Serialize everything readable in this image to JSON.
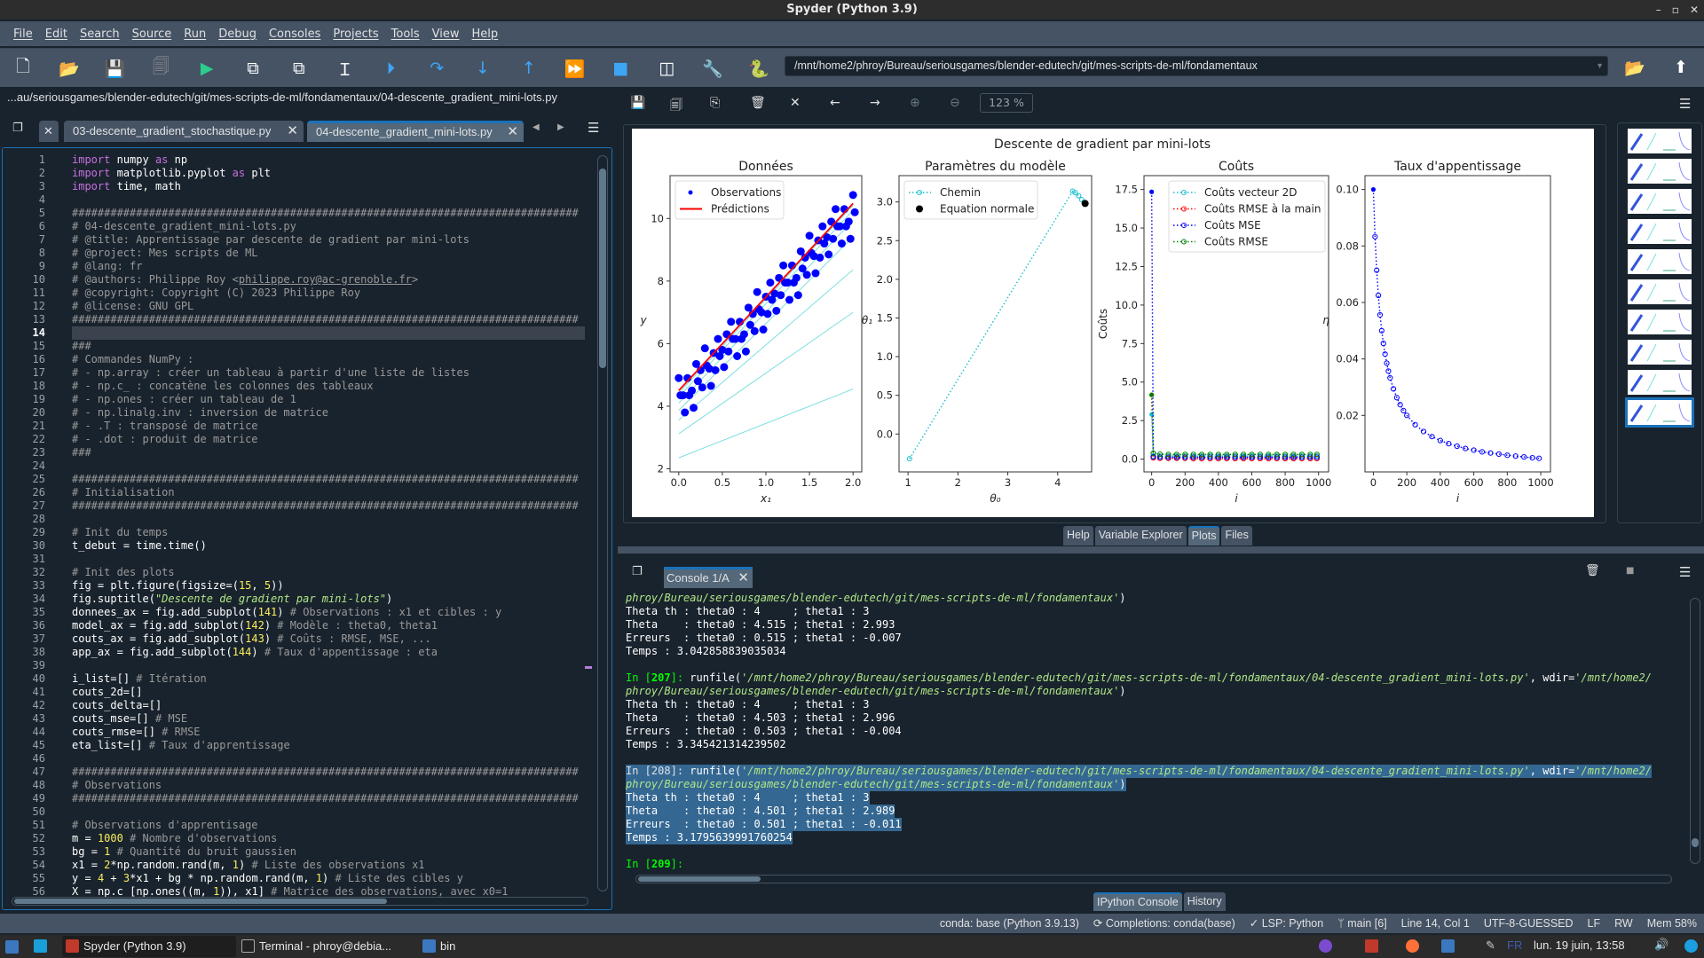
{
  "window": {
    "title": "Spyder (Python 3.9)",
    "controls": [
      "–",
      "▫",
      "✕"
    ]
  },
  "menu": [
    "File",
    "Edit",
    "Search",
    "Source",
    "Run",
    "Debug",
    "Consoles",
    "Projects",
    "Tools",
    "View",
    "Help"
  ],
  "toolbar": {
    "icons": [
      "new-file",
      "open-file",
      "save",
      "save-all",
      "run",
      "run-cell",
      "run-cell-advance",
      "run-selection",
      "debug",
      "step",
      "step-into",
      "step-return",
      "continue",
      "stop",
      "maximize-pane",
      "preferences",
      "python-path-manager"
    ],
    "working_dir": "/mnt/home2/phroy/Bureau/seriousgames/blender-edutech/git/mes-scripts-de-ml/fondamentaux"
  },
  "editor": {
    "path": "...au/seriousgames/blender-edutech/git/mes-scripts-de-ml/fondamentaux/04-descente_gradient_mini-lots.py",
    "tabs": [
      {
        "label": "03-descente_gradient_stochastique.py",
        "active": false
      },
      {
        "label": "04-descente_gradient_mini-lots.py",
        "active": true
      }
    ],
    "current_line": 14,
    "lines": [
      "import numpy as np",
      "import matplotlib.pyplot as plt",
      "import time, math",
      "",
      "###############################################################################",
      "# 04-descente_gradient_mini-lots.py",
      "# @title: Apprentissage par descente de gradient par mini-lots",
      "# @project: Mes scripts de ML",
      "# @lang: fr",
      "# @authors: Philippe Roy <philippe.roy@ac-grenoble.fr>",
      "# @copyright: Copyright (C) 2023 Philippe Roy",
      "# @license: GNU GPL",
      "###############################################################################",
      "",
      "###",
      "# Commandes NumPy :",
      "# - np.array : créer un tableau à partir d'une liste de listes",
      "# - np.c_ : concatène les colonnes des tableaux",
      "# - np.ones : créer un tableau de 1",
      "# - np.linalg.inv : inversion de matrice",
      "# - .T : transposé de matrice",
      "# - .dot : produit de matrice",
      "###",
      "",
      "###############################################################################",
      "# Initialisation",
      "###############################################################################",
      "",
      "# Init du temps",
      "t_debut = time.time()",
      "",
      "# Init des plots",
      "fig = plt.figure(figsize=(15, 5))",
      "fig.suptitle(\"Descente de gradient par mini-lots\")",
      "donnees_ax = fig.add_subplot(141) # Observations : x1 et cibles : y",
      "model_ax = fig.add_subplot(142) # Modèle : theta0, theta1",
      "couts_ax = fig.add_subplot(143) # Coûts : RMSE, MSE, ...",
      "app_ax = fig.add_subplot(144) # Taux d'appentissage : eta",
      "",
      "i_list=[] # Itération",
      "couts_2d=[]",
      "couts_delta=[]",
      "couts_mse=[] # MSE",
      "couts_rmse=[] # RMSE",
      "eta_list=[] # Taux d'apprentissage",
      "",
      "###############################################################################",
      "# Observations",
      "###############################################################################",
      "",
      "# Observations d'apprentisage",
      "m = 1000 # Nombre d'observations",
      "bg = 1 # Quantité du bruit gaussien",
      "x1 = 2*np.random.rand(m, 1) # Liste des observations x1",
      "y = 4 + 3*x1 + bg * np.random.rand(m, 1) # Liste des cibles y",
      "X = np.c_[np.ones((m, 1)), x1] # Matrice des observations, avec x0=1"
    ]
  },
  "plots": {
    "zoom": "123 %",
    "toolbar_icons": [
      "save-plot",
      "save-all-plots",
      "copy",
      "remove",
      "remove-all",
      "previous",
      "next",
      "zoom-in",
      "zoom-out"
    ],
    "thumbnail_count": 10,
    "selected_thumbnail": 10
  },
  "pane_tabs": [
    {
      "label": "Help",
      "active": false
    },
    {
      "label": "Variable Explorer",
      "active": false
    },
    {
      "label": "Plots",
      "active": true
    },
    {
      "label": "Files",
      "active": false
    }
  ],
  "console": {
    "tab": "Console 1/A",
    "lines": [
      {
        "t": "cont",
        "text": "phroy/Bureau/seriousgames/blender-edutech/git/mes-scripts-de-ml/fondamentaux'",
        "tail": ")"
      },
      {
        "t": "out",
        "text": "Theta th : theta0 : 4     ; theta1 : 3"
      },
      {
        "t": "out",
        "text": "Theta    : theta0 : 4.515 ; theta1 : 2.993"
      },
      {
        "t": "out",
        "text": "Erreurs  : theta0 : 0.515 ; theta1 : -0.007"
      },
      {
        "t": "out",
        "text": "Temps : 3.042858839035034"
      },
      {
        "t": "out",
        "text": ""
      },
      {
        "t": "cmd",
        "n": "207",
        "pre": "runfile(",
        "s1": "'/mnt/home2/phroy/Bureau/seriousgames/blender-edutech/git/mes-scripts-de-ml/fondamentaux/04-descente_gradient_mini-lots.py'",
        "mid": ", wdir=",
        "s2": "'/mnt/home2/"
      },
      {
        "t": "cont",
        "text": "phroy/Bureau/seriousgames/blender-edutech/git/mes-scripts-de-ml/fondamentaux'",
        "tail": ")"
      },
      {
        "t": "out",
        "text": "Theta th : theta0 : 4     ; theta1 : 3"
      },
      {
        "t": "out",
        "text": "Theta    : theta0 : 4.503 ; theta1 : 2.996"
      },
      {
        "t": "out",
        "text": "Erreurs  : theta0 : 0.503 ; theta1 : -0.004"
      },
      {
        "t": "out",
        "text": "Temps : 3.345421314239502"
      },
      {
        "t": "out",
        "text": ""
      },
      {
        "t": "cmd",
        "sel": true,
        "n": "208",
        "pre": "runfile(",
        "s1": "'/mnt/home2/phroy/Bureau/seriousgames/blender-edutech/git/mes-scripts-de-ml/fondamentaux/04-descente_gradient_mini-lots.py'",
        "mid": ", wdir=",
        "s2": "'/mnt/home2/"
      },
      {
        "t": "cont",
        "sel": true,
        "text": "phroy/Bureau/seriousgames/blender-edutech/git/mes-scripts-de-ml/fondamentaux'",
        "tail": ")"
      },
      {
        "t": "out",
        "sel": true,
        "text": "Theta th : theta0 : 4     ; theta1 : 3"
      },
      {
        "t": "out",
        "sel": true,
        "text": "Theta    : theta0 : 4.501 ; theta1 : 2.989"
      },
      {
        "t": "out",
        "sel": true,
        "text": "Erreurs  : theta0 : 0.501 ; theta1 : -0.011"
      },
      {
        "t": "out",
        "sel": true,
        "text": "Temps : 3.1795639991760254"
      },
      {
        "t": "out",
        "text": ""
      },
      {
        "t": "prompt",
        "n": "209"
      }
    ]
  },
  "bottom_tabs": [
    {
      "label": "IPython Console",
      "active": true
    },
    {
      "label": "History",
      "active": false
    }
  ],
  "status": {
    "conda": "conda: base (Python 3.9.13)",
    "completions": "Completions: conda(base)",
    "lsp": "LSP: Python",
    "git": "main [6]",
    "position": "Line 14, Col 1",
    "encoding": "UTF-8-GUESSED",
    "eol": "LF",
    "rw": "RW",
    "mem": "Mem 58%"
  },
  "taskbar": {
    "tasks": [
      "Spyder (Python 3.9)",
      "Terminal - phroy@debia...",
      "bin"
    ],
    "lang": "FR",
    "clock": "lun. 19 juin, 13:58"
  },
  "colors": {
    "accent": "#1a72bb",
    "bg": "#19232D",
    "panel": "#455364",
    "selection": "#346792"
  },
  "chart_data": [
    {
      "suptitle": "Descente de gradient par mini-lots"
    },
    {
      "type": "scatter",
      "title": "Données",
      "xlabel": "x₁",
      "ylabel": "y",
      "xlim": [
        -0.1,
        2.1
      ],
      "ylim": [
        1.9,
        11.37
      ],
      "xticks": [
        0.0,
        0.5,
        1.0,
        1.5,
        2.0
      ],
      "xticklabels": [
        "0.0",
        "0.5",
        "1.0",
        "1.5",
        "2.0"
      ],
      "yticks": [
        2,
        4,
        6,
        8,
        10
      ],
      "yticklabels": [
        "2",
        "4",
        "6",
        "8",
        "10"
      ],
      "legend": {
        "placement": "upper-left",
        "entries": [
          "Observations",
          "Prédictions"
        ]
      },
      "observations": {
        "color": "#0000ff",
        "x": [
          0,
          0.05,
          0.1,
          0.15,
          0.2,
          0.25,
          0.3,
          0.35,
          0.4,
          0.45,
          0.5,
          0.55,
          0.6,
          0.65,
          0.7,
          0.75,
          0.8,
          0.85,
          0.9,
          0.95,
          1.0,
          1.05,
          1.1,
          1.15,
          1.2,
          1.25,
          1.3,
          1.35,
          1.4,
          1.45,
          1.5,
          1.55,
          1.6,
          1.65,
          1.7,
          1.75,
          1.8,
          1.85,
          1.9,
          1.95,
          2.0
        ],
        "y": [
          4.9,
          4.35,
          4.9,
          4.5,
          5.35,
          5.15,
          5.85,
          5.2,
          5.7,
          6.15,
          5.8,
          6.3,
          6.7,
          6.15,
          6.7,
          6.3,
          7.15,
          6.95,
          7.65,
          7.0,
          7.5,
          7.95,
          7.6,
          8.1,
          8.5,
          7.95,
          8.5,
          8.1,
          8.95,
          8.75,
          9.45,
          8.8,
          9.3,
          9.75,
          9.4,
          9.9,
          10.3,
          9.75,
          10.3,
          9.9,
          10.75
        ]
      },
      "path_lines": {
        "color": "#7fdfdf",
        "lines": [
          [
            2.35,
            1.1
          ],
          [
            3.12,
            1.94
          ],
          [
            3.56,
            2.4
          ],
          [
            3.87,
            2.77
          ],
          [
            4.1,
            2.92
          ],
          [
            4.3,
            2.98
          ],
          [
            4.42,
            3.0
          ]
        ]
      },
      "prediction": {
        "color": "#ff0000",
        "theta0": 4.501,
        "theta1": 2.989
      }
    },
    {
      "type": "line",
      "title": "Paramètres du modèle",
      "xlabel": "θ₀",
      "ylabel": "θ₁",
      "xlim": [
        0.82,
        4.68
      ],
      "ylim": [
        -0.49,
        3.34
      ],
      "xticks": [
        1,
        2,
        3,
        4
      ],
      "xticklabels": [
        "1",
        "2",
        "3",
        "4"
      ],
      "yticks": [
        0,
        0.5,
        1,
        1.5,
        2,
        2.5,
        3
      ],
      "yticklabels": [
        "0.0",
        "0.5",
        "1.0",
        "1.5",
        "2.0",
        "2.5",
        "3.0"
      ],
      "legend": {
        "placement": "upper-left",
        "entries": [
          "Chemin",
          "Equation normale"
        ]
      },
      "path": {
        "color": "#17becf",
        "x": [
          1.03,
          4.3,
          4.35,
          4.42,
          4.48,
          4.53
        ],
        "y": [
          -0.32,
          3.14,
          3.12,
          3.08,
          3.03,
          2.99
        ]
      },
      "normal_equation": {
        "color": "#000000",
        "x": 4.55,
        "y": 2.98
      }
    },
    {
      "type": "line",
      "title": "Coûts",
      "xlabel": "i",
      "ylabel": "Coûts",
      "xlim": [
        -46,
        1060
      ],
      "ylim": [
        -0.83,
        18.4
      ],
      "xticks": [
        0,
        200,
        400,
        600,
        800,
        1000
      ],
      "xticklabels": [
        "0",
        "200",
        "400",
        "600",
        "800",
        "1000"
      ],
      "yticks": [
        0,
        2.5,
        5,
        7.5,
        10,
        12.5,
        15,
        17.5
      ],
      "yticklabels": [
        "0.0",
        "2.5",
        "5.0",
        "7.5",
        "10.0",
        "12.5",
        "15.0",
        "17.5"
      ],
      "legend": {
        "placement": "upper-right"
      },
      "x": [
        0,
        10,
        50,
        100,
        150,
        200,
        250,
        300,
        350,
        400,
        450,
        500,
        550,
        600,
        650,
        700,
        750,
        800,
        850,
        900,
        950,
        990
      ],
      "series": [
        {
          "name": "Coûts vecteur 2D",
          "color": "#17becf",
          "values": [
            2.9,
            0.2,
            0.2,
            0.2,
            0.2,
            0.2,
            0.2,
            0.2,
            0.2,
            0.2,
            0.2,
            0.2,
            0.2,
            0.2,
            0.2,
            0.2,
            0.2,
            0.2,
            0.2,
            0.2,
            0.2,
            0.2
          ]
        },
        {
          "name": "Coûts RMSE à la main",
          "color": "#ff0000",
          "values": [
            4.17,
            0.08,
            0.05,
            0.05,
            0.05,
            0.05,
            0.03,
            0.03,
            0.03,
            0.03,
            0.03,
            0.03,
            0.03,
            0.03,
            0.03,
            0.03,
            0.03,
            0.03,
            0.03,
            0.03,
            0.03,
            0.03
          ]
        },
        {
          "name": "Coûts MSE",
          "color": "#0000ff",
          "values": [
            17.35,
            0.15,
            0.12,
            0.12,
            0.12,
            0.12,
            0.12,
            0.12,
            0.12,
            0.12,
            0.12,
            0.12,
            0.12,
            0.12,
            0.12,
            0.12,
            0.12,
            0.12,
            0.12,
            0.12,
            0.12,
            0.12
          ]
        },
        {
          "name": "Coûts RMSE",
          "color": "#008000",
          "values": [
            4.17,
            0.38,
            0.32,
            0.3,
            0.3,
            0.3,
            0.3,
            0.3,
            0.3,
            0.3,
            0.3,
            0.3,
            0.3,
            0.3,
            0.3,
            0.3,
            0.3,
            0.3,
            0.3,
            0.3,
            0.3,
            0.3
          ]
        }
      ]
    },
    {
      "type": "line",
      "title": "Taux d'appentissage",
      "xlabel": "i",
      "ylabel": "η",
      "xlim": [
        -50,
        1058
      ],
      "ylim": [
        0,
        0.1049
      ],
      "xticks": [
        0,
        200,
        400,
        600,
        800,
        1000
      ],
      "xticklabels": [
        "0",
        "200",
        "400",
        "600",
        "800",
        "1000"
      ],
      "yticks": [
        0.02,
        0.04,
        0.06,
        0.08,
        0.1
      ],
      "yticklabels": [
        "0.02",
        "0.04",
        "0.06",
        "0.08",
        "0.10"
      ],
      "series": [
        {
          "color": "#0000ff",
          "x": [
            0,
            10,
            20,
            30,
            40,
            50,
            60,
            70,
            80,
            90,
            100,
            120,
            140,
            160,
            180,
            200,
            250,
            300,
            350,
            400,
            450,
            500,
            550,
            600,
            650,
            700,
            750,
            800,
            850,
            900,
            950,
            990
          ],
          "values": [
            0.1,
            0.0833,
            0.0714,
            0.0625,
            0.0556,
            0.05,
            0.0455,
            0.0417,
            0.0385,
            0.0357,
            0.0333,
            0.0294,
            0.0263,
            0.0238,
            0.0217,
            0.02,
            0.0167,
            0.0143,
            0.0125,
            0.0111,
            0.01,
            0.0091,
            0.0083,
            0.0077,
            0.0071,
            0.0067,
            0.0063,
            0.0059,
            0.0056,
            0.0053,
            0.005,
            0.0048
          ]
        }
      ]
    }
  ]
}
